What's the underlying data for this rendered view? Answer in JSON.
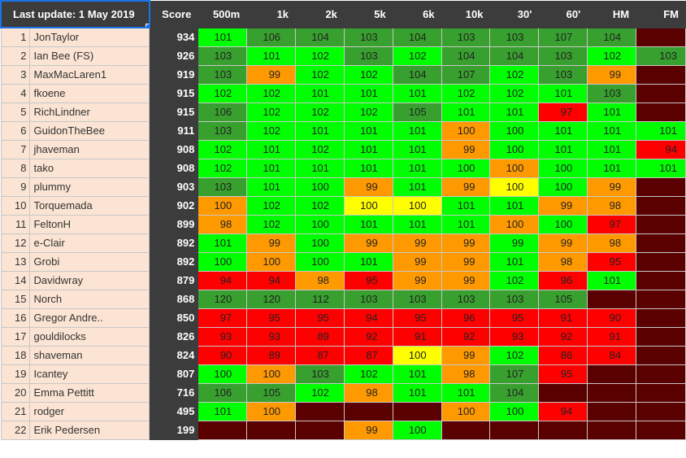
{
  "header": {
    "last_update": "Last update: 1 May 2019",
    "columns": [
      "Score",
      "500m",
      "1k",
      "2k",
      "5k",
      "6k",
      "10k",
      "30'",
      "60'",
      "HM",
      "FM"
    ]
  },
  "colors": {
    "dark_green": "#38a02e",
    "green": "#00ff00",
    "orange": "#ff9900",
    "yellow": "#ffff00",
    "red": "#ff0000",
    "maroon": "#5b0000",
    "name_bg": "#fbe4d3",
    "header_bg": "#3c3c3c"
  },
  "rows": [
    {
      "rank": "1",
      "name": "JonTaylor",
      "score": "934",
      "cells": [
        {
          "v": "101",
          "c": "g"
        },
        {
          "v": "106",
          "c": "dg"
        },
        {
          "v": "104",
          "c": "dg"
        },
        {
          "v": "103",
          "c": "dg"
        },
        {
          "v": "104",
          "c": "dg"
        },
        {
          "v": "103",
          "c": "dg"
        },
        {
          "v": "103",
          "c": "dg"
        },
        {
          "v": "107",
          "c": "dg"
        },
        {
          "v": "104",
          "c": "dg"
        },
        {
          "v": "",
          "c": "m"
        }
      ]
    },
    {
      "rank": "2",
      "name": "Ian Bee (FS)",
      "score": "926",
      "cells": [
        {
          "v": "103",
          "c": "dg"
        },
        {
          "v": "101",
          "c": "g"
        },
        {
          "v": "102",
          "c": "g"
        },
        {
          "v": "103",
          "c": "dg"
        },
        {
          "v": "102",
          "c": "g"
        },
        {
          "v": "104",
          "c": "dg"
        },
        {
          "v": "104",
          "c": "dg"
        },
        {
          "v": "103",
          "c": "dg"
        },
        {
          "v": "102",
          "c": "g"
        },
        {
          "v": "103",
          "c": "dg"
        }
      ]
    },
    {
      "rank": "3",
      "name": "MaxMacLaren1",
      "score": "919",
      "cells": [
        {
          "v": "103",
          "c": "dg"
        },
        {
          "v": "99",
          "c": "o"
        },
        {
          "v": "102",
          "c": "g"
        },
        {
          "v": "102",
          "c": "g"
        },
        {
          "v": "104",
          "c": "dg"
        },
        {
          "v": "107",
          "c": "dg"
        },
        {
          "v": "102",
          "c": "g"
        },
        {
          "v": "103",
          "c": "dg"
        },
        {
          "v": "99",
          "c": "o"
        },
        {
          "v": "",
          "c": "m"
        }
      ]
    },
    {
      "rank": "4",
      "name": "fkoene",
      "score": "915",
      "cells": [
        {
          "v": "102",
          "c": "g"
        },
        {
          "v": "102",
          "c": "g"
        },
        {
          "v": "101",
          "c": "g"
        },
        {
          "v": "101",
          "c": "g"
        },
        {
          "v": "101",
          "c": "g"
        },
        {
          "v": "102",
          "c": "g"
        },
        {
          "v": "102",
          "c": "g"
        },
        {
          "v": "101",
          "c": "g"
        },
        {
          "v": "103",
          "c": "dg"
        },
        {
          "v": "",
          "c": "m"
        }
      ]
    },
    {
      "rank": "5",
      "name": "RichLindner",
      "score": "915",
      "cells": [
        {
          "v": "106",
          "c": "dg"
        },
        {
          "v": "102",
          "c": "g"
        },
        {
          "v": "102",
          "c": "g"
        },
        {
          "v": "102",
          "c": "g"
        },
        {
          "v": "105",
          "c": "dg"
        },
        {
          "v": "101",
          "c": "g"
        },
        {
          "v": "101",
          "c": "g"
        },
        {
          "v": "97",
          "c": "r"
        },
        {
          "v": "101",
          "c": "g"
        },
        {
          "v": "",
          "c": "m"
        }
      ]
    },
    {
      "rank": "6",
      "name": "GuidonTheBee",
      "score": "911",
      "cells": [
        {
          "v": "103",
          "c": "dg"
        },
        {
          "v": "102",
          "c": "g"
        },
        {
          "v": "101",
          "c": "g"
        },
        {
          "v": "101",
          "c": "g"
        },
        {
          "v": "101",
          "c": "g"
        },
        {
          "v": "100",
          "c": "o"
        },
        {
          "v": "100",
          "c": "g"
        },
        {
          "v": "101",
          "c": "g"
        },
        {
          "v": "101",
          "c": "g"
        },
        {
          "v": "101",
          "c": "g"
        }
      ]
    },
    {
      "rank": "7",
      "name": "jhaveman",
      "score": "908",
      "cells": [
        {
          "v": "102",
          "c": "g"
        },
        {
          "v": "101",
          "c": "g"
        },
        {
          "v": "102",
          "c": "g"
        },
        {
          "v": "101",
          "c": "g"
        },
        {
          "v": "101",
          "c": "g"
        },
        {
          "v": "99",
          "c": "o"
        },
        {
          "v": "100",
          "c": "g"
        },
        {
          "v": "101",
          "c": "g"
        },
        {
          "v": "101",
          "c": "g"
        },
        {
          "v": "94",
          "c": "r"
        }
      ]
    },
    {
      "rank": "8",
      "name": "tako",
      "score": "908",
      "cells": [
        {
          "v": "102",
          "c": "g"
        },
        {
          "v": "101",
          "c": "g"
        },
        {
          "v": "101",
          "c": "g"
        },
        {
          "v": "101",
          "c": "g"
        },
        {
          "v": "101",
          "c": "g"
        },
        {
          "v": "100",
          "c": "g"
        },
        {
          "v": "100",
          "c": "o"
        },
        {
          "v": "100",
          "c": "g"
        },
        {
          "v": "101",
          "c": "g"
        },
        {
          "v": "101",
          "c": "g"
        }
      ]
    },
    {
      "rank": "9",
      "name": "plummy",
      "score": "903",
      "cells": [
        {
          "v": "103",
          "c": "dg"
        },
        {
          "v": "101",
          "c": "g"
        },
        {
          "v": "100",
          "c": "g"
        },
        {
          "v": "99",
          "c": "o"
        },
        {
          "v": "101",
          "c": "g"
        },
        {
          "v": "99",
          "c": "o"
        },
        {
          "v": "100",
          "c": "y"
        },
        {
          "v": "100",
          "c": "g"
        },
        {
          "v": "99",
          "c": "o"
        },
        {
          "v": "",
          "c": "m"
        }
      ]
    },
    {
      "rank": "10",
      "name": "Torquemada",
      "score": "902",
      "cells": [
        {
          "v": "100",
          "c": "o"
        },
        {
          "v": "102",
          "c": "g"
        },
        {
          "v": "102",
          "c": "g"
        },
        {
          "v": "100",
          "c": "y"
        },
        {
          "v": "100",
          "c": "y"
        },
        {
          "v": "101",
          "c": "g"
        },
        {
          "v": "101",
          "c": "g"
        },
        {
          "v": "99",
          "c": "o"
        },
        {
          "v": "98",
          "c": "o"
        },
        {
          "v": "",
          "c": "m"
        }
      ]
    },
    {
      "rank": "11",
      "name": "FeltonH",
      "score": "899",
      "cells": [
        {
          "v": "98",
          "c": "o"
        },
        {
          "v": "102",
          "c": "g"
        },
        {
          "v": "100",
          "c": "g"
        },
        {
          "v": "101",
          "c": "g"
        },
        {
          "v": "101",
          "c": "g"
        },
        {
          "v": "101",
          "c": "g"
        },
        {
          "v": "100",
          "c": "o"
        },
        {
          "v": "100",
          "c": "g"
        },
        {
          "v": "97",
          "c": "r"
        },
        {
          "v": "",
          "c": "m"
        }
      ]
    },
    {
      "rank": "12",
      "name": "e-Clair",
      "score": "892",
      "cells": [
        {
          "v": "101",
          "c": "g"
        },
        {
          "v": "99",
          "c": "o"
        },
        {
          "v": "100",
          "c": "g"
        },
        {
          "v": "99",
          "c": "o"
        },
        {
          "v": "99",
          "c": "o"
        },
        {
          "v": "99",
          "c": "o"
        },
        {
          "v": "99",
          "c": "g"
        },
        {
          "v": "99",
          "c": "o"
        },
        {
          "v": "98",
          "c": "o"
        },
        {
          "v": "",
          "c": "m"
        }
      ]
    },
    {
      "rank": "13",
      "name": "Grobi",
      "score": "892",
      "cells": [
        {
          "v": "100",
          "c": "g"
        },
        {
          "v": "100",
          "c": "o"
        },
        {
          "v": "100",
          "c": "g"
        },
        {
          "v": "101",
          "c": "g"
        },
        {
          "v": "99",
          "c": "o"
        },
        {
          "v": "99",
          "c": "o"
        },
        {
          "v": "101",
          "c": "g"
        },
        {
          "v": "98",
          "c": "o"
        },
        {
          "v": "95",
          "c": "r"
        },
        {
          "v": "",
          "c": "m"
        }
      ]
    },
    {
      "rank": "14",
      "name": "Davidwray",
      "score": "879",
      "cells": [
        {
          "v": "94",
          "c": "r"
        },
        {
          "v": "94",
          "c": "r"
        },
        {
          "v": "98",
          "c": "o"
        },
        {
          "v": "95",
          "c": "r"
        },
        {
          "v": "99",
          "c": "o"
        },
        {
          "v": "99",
          "c": "o"
        },
        {
          "v": "102",
          "c": "g"
        },
        {
          "v": "96",
          "c": "r"
        },
        {
          "v": "101",
          "c": "g"
        },
        {
          "v": "",
          "c": "m"
        }
      ]
    },
    {
      "rank": "15",
      "name": "Norch",
      "score": "868",
      "cells": [
        {
          "v": "120",
          "c": "dg"
        },
        {
          "v": "120",
          "c": "dg"
        },
        {
          "v": "112",
          "c": "dg"
        },
        {
          "v": "103",
          "c": "dg"
        },
        {
          "v": "103",
          "c": "dg"
        },
        {
          "v": "103",
          "c": "dg"
        },
        {
          "v": "103",
          "c": "dg"
        },
        {
          "v": "105",
          "c": "dg"
        },
        {
          "v": "",
          "c": "m"
        },
        {
          "v": "",
          "c": "m"
        }
      ]
    },
    {
      "rank": "16",
      "name": "Gregor Andre..",
      "score": "850",
      "cells": [
        {
          "v": "97",
          "c": "r"
        },
        {
          "v": "95",
          "c": "r"
        },
        {
          "v": "95",
          "c": "r"
        },
        {
          "v": "94",
          "c": "r"
        },
        {
          "v": "95",
          "c": "r"
        },
        {
          "v": "96",
          "c": "r"
        },
        {
          "v": "95",
          "c": "r"
        },
        {
          "v": "91",
          "c": "r"
        },
        {
          "v": "90",
          "c": "r"
        },
        {
          "v": "",
          "c": "m"
        }
      ]
    },
    {
      "rank": "17",
      "name": "gouldilocks",
      "score": "826",
      "cells": [
        {
          "v": "93",
          "c": "r"
        },
        {
          "v": "93",
          "c": "r"
        },
        {
          "v": "89",
          "c": "r"
        },
        {
          "v": "92",
          "c": "r"
        },
        {
          "v": "91",
          "c": "r"
        },
        {
          "v": "92",
          "c": "r"
        },
        {
          "v": "93",
          "c": "r"
        },
        {
          "v": "92",
          "c": "r"
        },
        {
          "v": "91",
          "c": "r"
        },
        {
          "v": "",
          "c": "m"
        }
      ]
    },
    {
      "rank": "18",
      "name": "shaveman",
      "score": "824",
      "cells": [
        {
          "v": "90",
          "c": "r"
        },
        {
          "v": "89",
          "c": "r"
        },
        {
          "v": "87",
          "c": "r"
        },
        {
          "v": "87",
          "c": "r"
        },
        {
          "v": "100",
          "c": "y"
        },
        {
          "v": "99",
          "c": "o"
        },
        {
          "v": "102",
          "c": "g"
        },
        {
          "v": "86",
          "c": "r"
        },
        {
          "v": "84",
          "c": "r"
        },
        {
          "v": "",
          "c": "m"
        }
      ]
    },
    {
      "rank": "19",
      "name": "Icantey",
      "score": "807",
      "cells": [
        {
          "v": "100",
          "c": "g"
        },
        {
          "v": "100",
          "c": "o"
        },
        {
          "v": "103",
          "c": "dg"
        },
        {
          "v": "102",
          "c": "g"
        },
        {
          "v": "101",
          "c": "g"
        },
        {
          "v": "98",
          "c": "o"
        },
        {
          "v": "107",
          "c": "dg"
        },
        {
          "v": "95",
          "c": "r"
        },
        {
          "v": "",
          "c": "m"
        },
        {
          "v": "",
          "c": "m"
        }
      ]
    },
    {
      "rank": "20",
      "name": "Emma Pettitt",
      "score": "716",
      "cells": [
        {
          "v": "106",
          "c": "dg"
        },
        {
          "v": "105",
          "c": "dg"
        },
        {
          "v": "102",
          "c": "g"
        },
        {
          "v": "98",
          "c": "o"
        },
        {
          "v": "101",
          "c": "g"
        },
        {
          "v": "101",
          "c": "g"
        },
        {
          "v": "104",
          "c": "dg"
        },
        {
          "v": "",
          "c": "m"
        },
        {
          "v": "",
          "c": "m"
        },
        {
          "v": "",
          "c": "m"
        }
      ]
    },
    {
      "rank": "21",
      "name": "rodger",
      "score": "495",
      "cells": [
        {
          "v": "101",
          "c": "g"
        },
        {
          "v": "100",
          "c": "o"
        },
        {
          "v": "",
          "c": "m"
        },
        {
          "v": "",
          "c": "m"
        },
        {
          "v": "",
          "c": "m"
        },
        {
          "v": "100",
          "c": "o"
        },
        {
          "v": "100",
          "c": "g"
        },
        {
          "v": "94",
          "c": "r"
        },
        {
          "v": "",
          "c": "m"
        },
        {
          "v": "",
          "c": "m"
        }
      ]
    },
    {
      "rank": "22",
      "name": "Erik Pedersen",
      "score": "199",
      "cells": [
        {
          "v": "",
          "c": "m"
        },
        {
          "v": "",
          "c": "m"
        },
        {
          "v": "",
          "c": "m"
        },
        {
          "v": "99",
          "c": "o"
        },
        {
          "v": "100",
          "c": "g"
        },
        {
          "v": "",
          "c": "m"
        },
        {
          "v": "",
          "c": "m"
        },
        {
          "v": "",
          "c": "m"
        },
        {
          "v": "",
          "c": "m"
        },
        {
          "v": "",
          "c": "m"
        }
      ]
    }
  ]
}
